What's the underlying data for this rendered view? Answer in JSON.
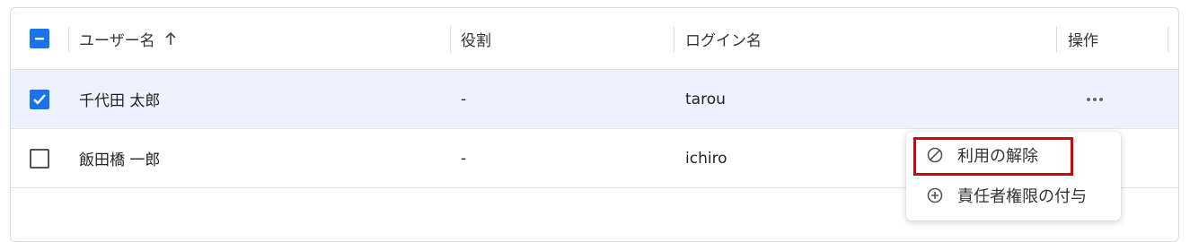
{
  "table": {
    "header": {
      "select_all_state": "indeterminate",
      "columns": [
        {
          "label": "ユーザー名",
          "sort": "ascending"
        },
        {
          "label": "役割"
        },
        {
          "label": "ログイン名"
        },
        {
          "label": "操作"
        }
      ]
    },
    "rows": [
      {
        "selected": true,
        "name": "千代田 太郎",
        "role": "-",
        "login": "tarou",
        "has_menu": true
      },
      {
        "selected": false,
        "name": "飯田橋 一郎",
        "role": "-",
        "login": "ichiro",
        "has_menu": false
      }
    ]
  },
  "context_menu": {
    "items": [
      {
        "label": "利用の解除",
        "icon": "block-icon",
        "highlighted": true
      },
      {
        "label": "責任者権限の付与",
        "icon": "add-circle-icon",
        "highlighted": false
      }
    ],
    "highlight_color": "#d7000f"
  },
  "colors": {
    "accent": "#1a73e8",
    "selected_row": "#edf3fc"
  }
}
